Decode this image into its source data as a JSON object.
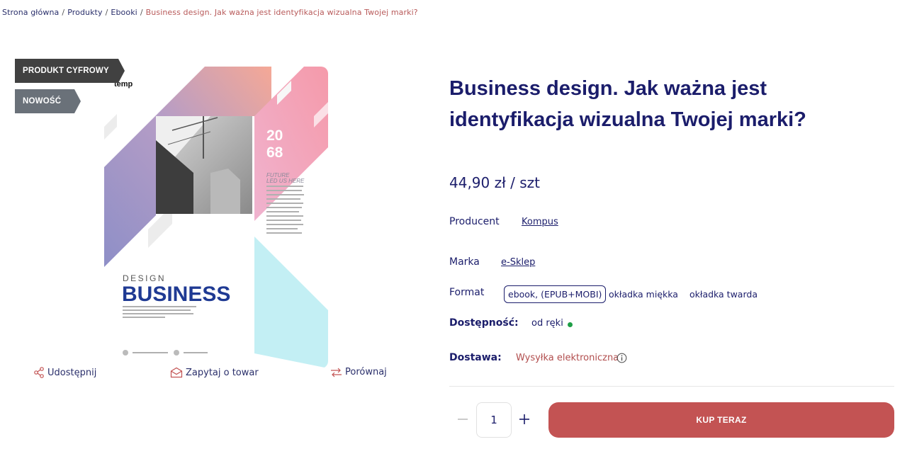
{
  "breadcrumb": {
    "home": "Strona główna",
    "products": "Produkty",
    "ebooks": "Ebooki",
    "current": "Business design. Jak ważna jest identyfikacja wizualna Twojej marki?",
    "separator": "/"
  },
  "badges": {
    "digital": "PRODUKT CYFROWY",
    "new": "NOWOŚĆ"
  },
  "cover": {
    "brand": "temp",
    "year_top": "20",
    "year_bottom": "68",
    "tagline_1": "FUTURE",
    "tagline_2": "LED US HERE",
    "kicker": "DESIGN",
    "headline": "BUSINESS"
  },
  "actions": {
    "share": "Udostępnij",
    "ask": "Zapytaj o towar",
    "compare": "Porównaj"
  },
  "product": {
    "title": "Business design. Jak ważna jest identyfikacja wizualna Twojej marki?",
    "price": "44,90 zł / szt"
  },
  "attributes": {
    "producer_label": "Producent",
    "producer_value": "Kompus",
    "brand_label": "Marka",
    "brand_value": "e-Sklep",
    "format_label": "Format",
    "formats": [
      "ebook, (EPUB+MOBI)",
      "okładka miękka",
      "okładka twarda"
    ],
    "availability_label": "Dostępność:",
    "availability_value": "od ręki",
    "delivery_label": "Dostawa:",
    "delivery_value": "Wysyłka elektroniczna"
  },
  "purchase": {
    "quantity": "1",
    "buy_label": "KUP TERAZ"
  },
  "colors": {
    "navy": "#1b1d6b",
    "accent": "#c35353",
    "available": "#1e9e46"
  }
}
